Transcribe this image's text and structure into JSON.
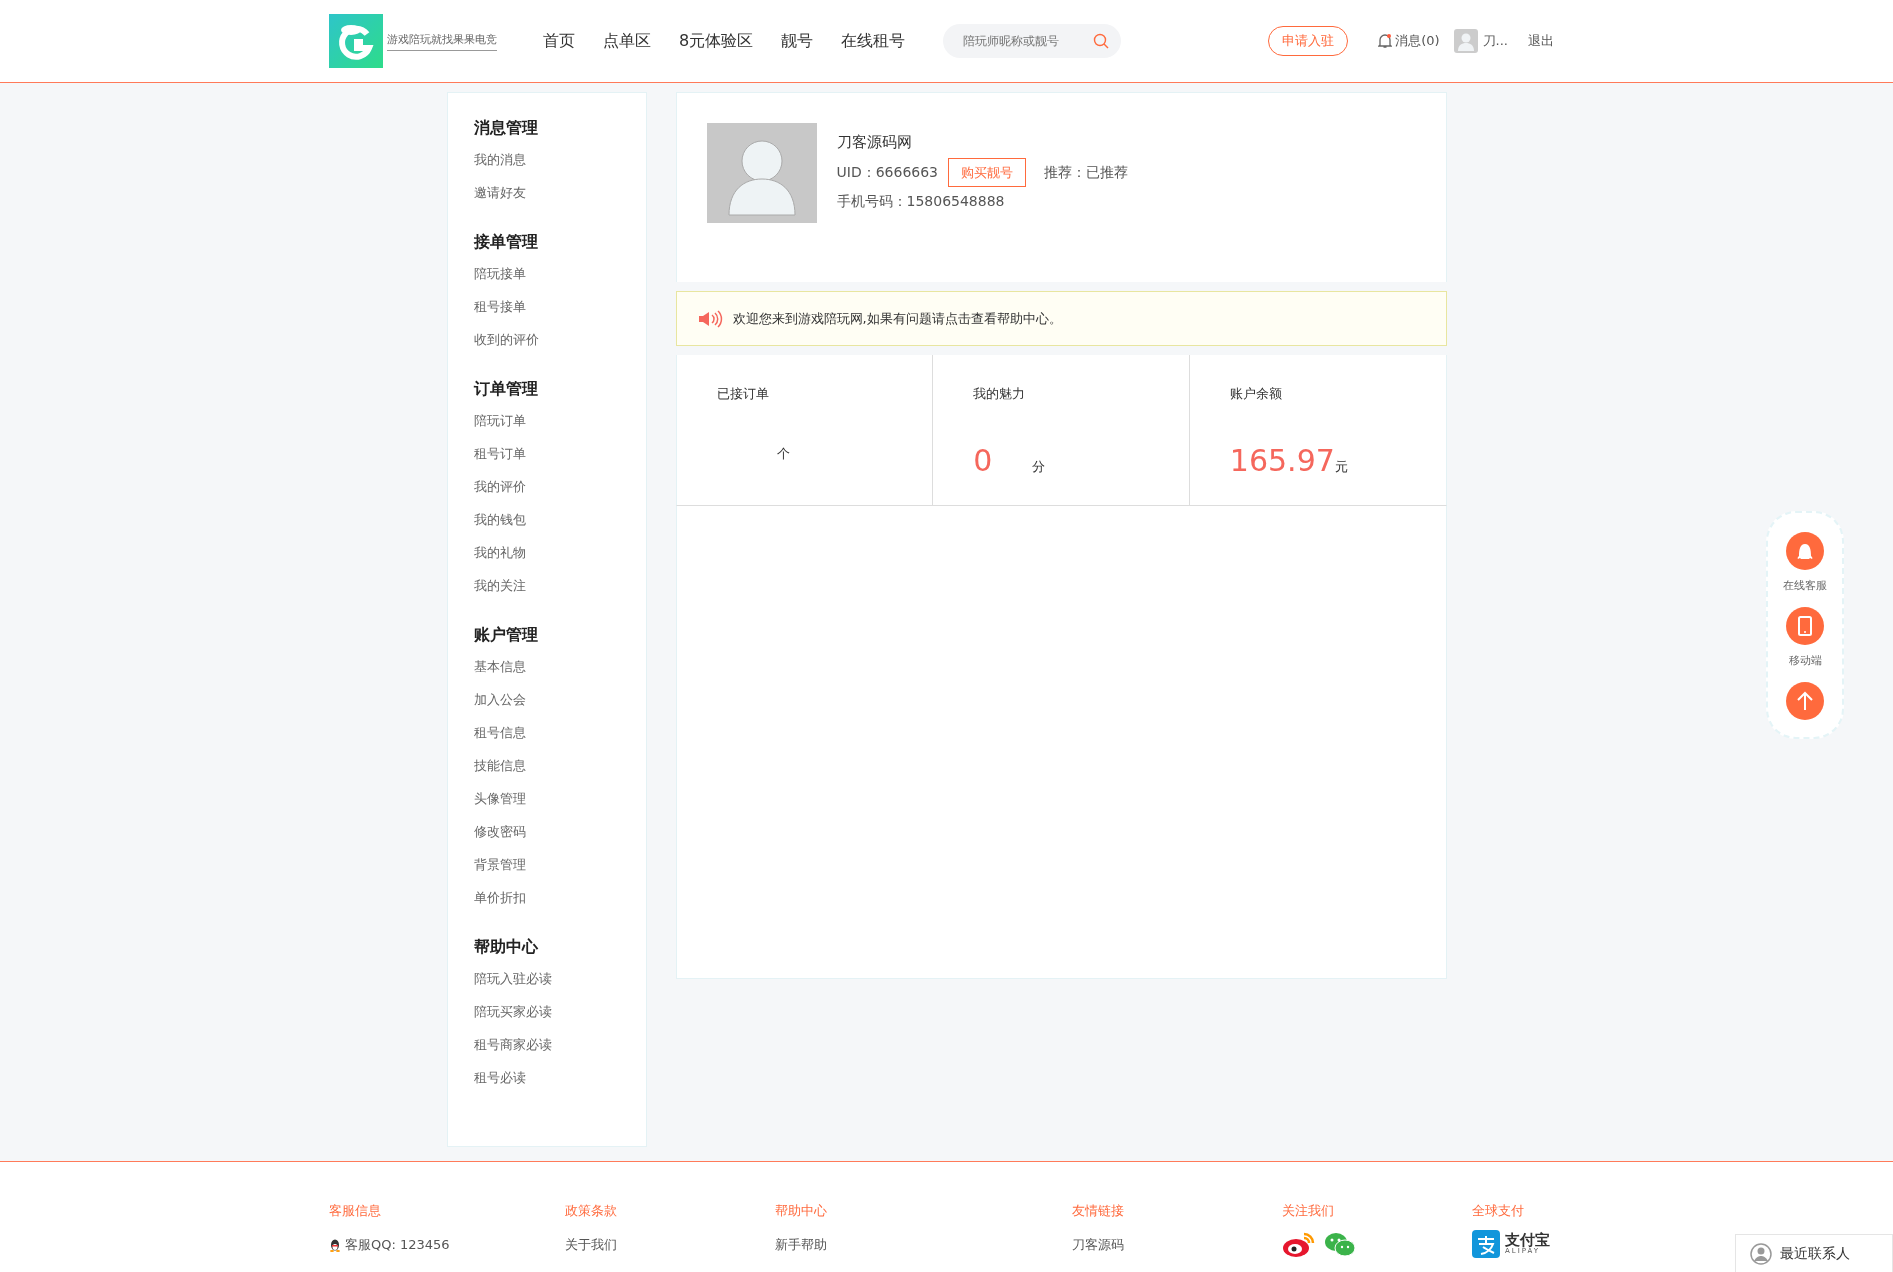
{
  "header": {
    "logo_text": "游戏陪玩就找果果电竞",
    "nav": [
      {
        "label": "首页",
        "selected": false
      },
      {
        "label": "点单区",
        "selected": false
      },
      {
        "label": "8元体验区",
        "selected": false
      },
      {
        "label": "靓号",
        "selected": false
      },
      {
        "label": "在线租号",
        "selected": false
      }
    ],
    "search": {
      "placeholder": "陪玩师昵称或靓号"
    },
    "apply_button": "申请入驻",
    "messages": "消息(0)",
    "user": "刀...",
    "logout": "退出"
  },
  "sidebar": [
    {
      "title": "消息管理",
      "items": [
        "我的消息",
        "邀请好友"
      ]
    },
    {
      "title": "接单管理",
      "items": [
        "陪玩接单",
        "租号接单",
        "收到的评价"
      ]
    },
    {
      "title": "订单管理",
      "items": [
        "陪玩订单",
        "租号订单",
        "我的评价",
        "我的钱包",
        "我的礼物",
        "我的关注"
      ]
    },
    {
      "title": "账户管理",
      "items": [
        "基本信息",
        "加入公会",
        "租号信息",
        "技能信息",
        "头像管理",
        "修改密码",
        "背景管理",
        "单价折扣"
      ]
    },
    {
      "title": "帮助中心",
      "items": [
        "陪玩入驻必读",
        "陪玩买家必读",
        "租号商家必读",
        "租号必读"
      ]
    }
  ],
  "profile": {
    "name": "刀客源码网",
    "uid": "UID：6666663",
    "buy_button": "购买靓号",
    "recommend": "推荐：已推荐",
    "phone": "手机号码：15806548888"
  },
  "notice": "欢迎您来到游戏陪玩网,如果有问题请点击查看帮助中心。",
  "stats": [
    {
      "label": "已接订单",
      "unit": "个"
    },
    {
      "label": "我的魅力",
      "value": "0",
      "unit": "分"
    },
    {
      "label": "账户余额",
      "value": "165.97",
      "unit": "元"
    }
  ],
  "float_bar": [
    {
      "kind": "qq",
      "label": "在线客服"
    },
    {
      "kind": "phone",
      "label": "移动端"
    },
    {
      "kind": "top"
    }
  ],
  "footer": [
    {
      "title": "客服信息",
      "kind": "qq",
      "item": "客服QQ: 123456"
    },
    {
      "title": "政策条款",
      "kind": "text",
      "item": "关于我们"
    },
    {
      "title": "帮助中心",
      "kind": "text",
      "item": "新手帮助"
    },
    {
      "title": "友情链接",
      "kind": "text",
      "item": "刀客源码"
    },
    {
      "title": "关注我们",
      "kind": "social"
    },
    {
      "title": "全球支付",
      "kind": "alipay",
      "item": "支付宝",
      "sub": "ALIPAY"
    }
  ],
  "chat_widget": "最近联系人"
}
